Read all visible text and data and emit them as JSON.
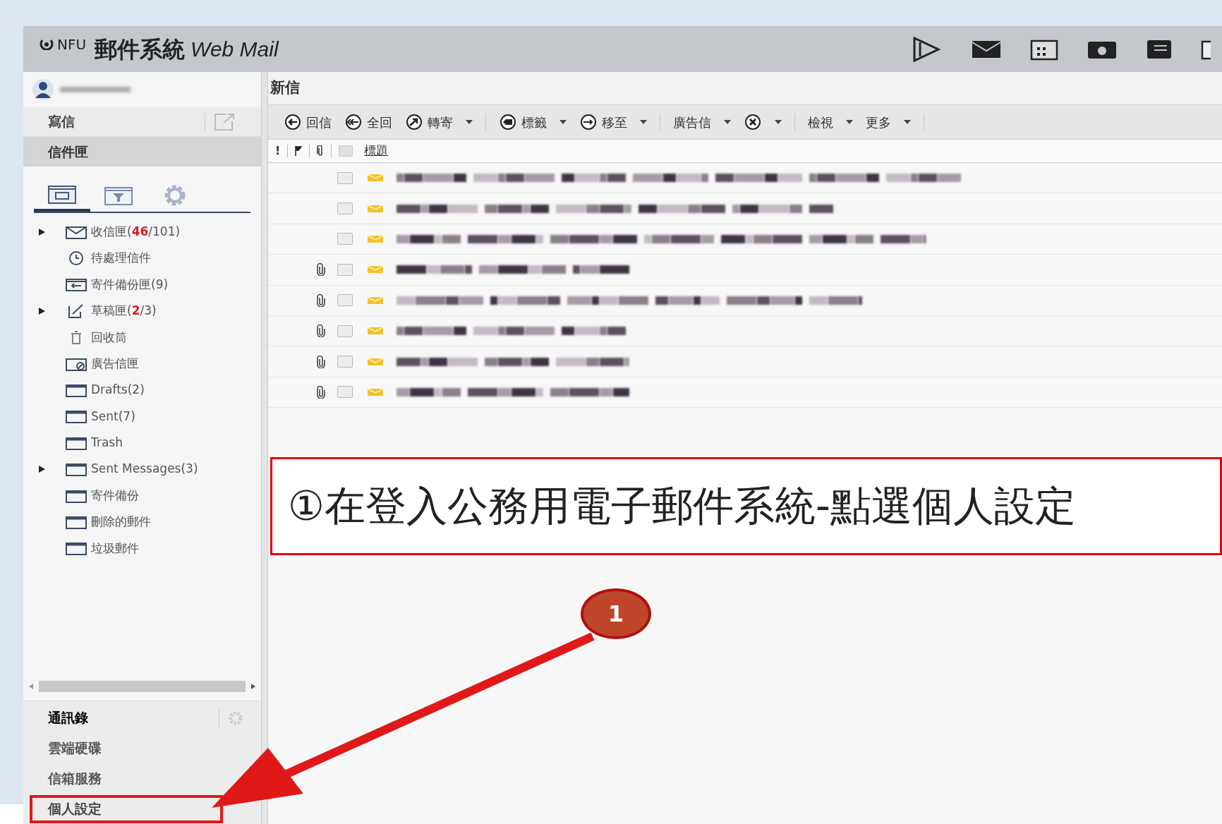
{
  "header": {
    "logo": "NFU",
    "title": "郵件系統",
    "subtitle": "Web Mail"
  },
  "sidebar": {
    "compose": "寫信",
    "mailbox": {
      "label": "信件匣",
      "selected": true
    },
    "tabs": [
      {
        "kind": "folders",
        "selected": true
      },
      {
        "kind": "filter",
        "selected": false
      },
      {
        "kind": "settings",
        "selected": false
      }
    ],
    "folders": [
      {
        "kind": "inbox",
        "label": "收信匣(",
        "unread": "46",
        "rest": "/101)",
        "expandable": true
      },
      {
        "kind": "clock",
        "label": "待處理信件",
        "expandable": false
      },
      {
        "kind": "sent",
        "label": "寄件備份匣(9)",
        "expandable": false
      },
      {
        "kind": "draft",
        "label": "草稿匣(",
        "unread": "2",
        "rest": "/3)",
        "expandable": true
      },
      {
        "kind": "recycle",
        "label": "回收筒",
        "expandable": false
      },
      {
        "kind": "spam",
        "label": "廣告信匣",
        "expandable": false
      },
      {
        "kind": "folder",
        "label": "Drafts(2)",
        "expandable": false
      },
      {
        "kind": "folder",
        "label": "Sent(7)",
        "expandable": false
      },
      {
        "kind": "folder",
        "label": "Trash",
        "expandable": false
      },
      {
        "kind": "folder",
        "label": "Sent Messages(3)",
        "expandable": true
      },
      {
        "kind": "folder",
        "label": "寄件備份",
        "expandable": false
      },
      {
        "kind": "folder",
        "label": "刪除的郵件",
        "expandable": false
      },
      {
        "kind": "folder",
        "label": "垃圾郵件",
        "expandable": false
      }
    ],
    "bottom_items": [
      {
        "label": "通訊錄",
        "settings": true,
        "highlighted": false
      },
      {
        "label": "雲端硬碟",
        "settings": false,
        "highlighted": false
      },
      {
        "label": "信箱服務",
        "settings": false,
        "highlighted": false
      },
      {
        "label": "個人設定",
        "settings": false,
        "highlighted": true
      }
    ]
  },
  "main": {
    "title": "新信",
    "toolbar": [
      {
        "buttons": [
          {
            "kind": "reply",
            "label": "回信",
            "dropdown": false
          },
          {
            "kind": "reply-all",
            "label": "全回",
            "dropdown": false
          },
          {
            "kind": "forward",
            "label": "轉寄",
            "dropdown": true
          }
        ]
      },
      {
        "buttons": [
          {
            "kind": "tag",
            "label": "標籤",
            "dropdown": true
          },
          {
            "kind": "move",
            "label": "移至",
            "dropdown": true
          }
        ]
      },
      {
        "buttons": [
          {
            "kind": "plain",
            "label": "廣告信",
            "dropdown": true
          },
          {
            "kind": "delete",
            "dropdown": true
          }
        ]
      },
      {
        "buttons": [
          {
            "kind": "plain",
            "label": "檢視",
            "dropdown": true
          },
          {
            "kind": "plain",
            "label": "更多",
            "dropdown": true
          }
        ]
      }
    ],
    "columns": {
      "priority": "!",
      "select_all_checked": false,
      "subject": "標題"
    },
    "rows": [
      {
        "attachment": false,
        "checked": false
      },
      {
        "attachment": false,
        "checked": false
      },
      {
        "attachment": false,
        "checked": false
      },
      {
        "attachment": true,
        "checked": false
      },
      {
        "attachment": true,
        "checked": false
      },
      {
        "attachment": true,
        "checked": false
      },
      {
        "attachment": true,
        "checked": false
      },
      {
        "attachment": true,
        "checked": false
      }
    ]
  },
  "annotation": {
    "callout": "①在登入公務用電子郵件系統-點選個人設定",
    "step": "1"
  }
}
